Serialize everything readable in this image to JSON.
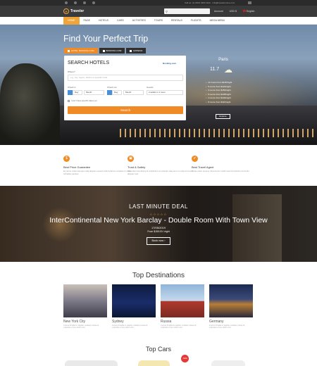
{
  "topbar": {
    "contact": "Call us: (1) 0023 4400 1122 · info@travelercome.com"
  },
  "header": {
    "brand": "Traveler",
    "account": "Account",
    "currency": "USD $",
    "language": "English"
  },
  "nav": [
    "HOME",
    "PAGE",
    "HOTELS",
    "CARS",
    "ACTIVITIES",
    "TOURS",
    "RENTALS",
    "FLIGHTS",
    "MEGA MENU"
  ],
  "hero": {
    "title": "Find Your Perfect Trip",
    "tabs": [
      "HOTEL BOOKING.COM",
      "BOOKING.COM",
      "EXPEDIA"
    ],
    "form": {
      "heading": "SEARCH HOTELS",
      "partner": "Booking.com",
      "where_label": "Where?",
      "where_placeholder": "e.g. city, region, district or specific hotel",
      "checkin_label": "Check in",
      "checkout_label": "Check out",
      "guests_label": "Guests",
      "day_value": "Day",
      "month_value": "Month",
      "guests_value": "2 adults in 1 room",
      "no_dates": "I don't have specific dates yet",
      "submit": "Search"
    },
    "weather": {
      "city": "Paris",
      "temp": "11.7",
      "items": [
        "12 rooms from $135/night",
        "5 rooms from $124/night",
        "3 rooms from $150/night",
        "6 rooms from $138/night",
        "4 rooms from $146/night",
        "8 rooms from $110/night"
      ],
      "explore": "Explore"
    }
  },
  "features": [
    {
      "title": "Best Price Guarantee",
      "desc": "Ex ferrus nolla mamqua nolla aliquam eseled nolla fuclamus vulpatus in nolla turbatilus pariatur.",
      "icon": "dollar-icon"
    },
    {
      "title": "Trust & Safety",
      "desc": "Imperdiet nisl ultrices id vestibulum at molestie vitae arcu ut nulla commodo aliquam sed.",
      "icon": "lock-icon"
    },
    {
      "title": "Best Travel Agent",
      "desc": "Curae etiam tempus rhoncus dui mollit viverra hendrerit commodo.",
      "icon": "thumbs-up-icon"
    }
  ],
  "deal": {
    "kicker": "LAST MINUTE DEAL",
    "title": "InterContinental New York Barclay - Double Room With Town View",
    "date": "17/05/2019",
    "price": "From $150.00 / night",
    "button": "Book now"
  },
  "destinations": {
    "heading": "Top Destinations",
    "items": [
      {
        "name": "New York City",
        "desc": "Cursus fringilla in sagittis, sodales massa id, vulputate a sem dolor eros."
      },
      {
        "name": "Sydney",
        "desc": "Cursus fringilla in sagittis, sodales massa id, vulputate a sem dolor eros."
      },
      {
        "name": "Russia",
        "desc": "Cursus fringilla in sagittis, sodales massa id, vulputate a sem dolor eros."
      },
      {
        "name": "Germany",
        "desc": "Cursus fringilla in sagittis, sodales massa id, vulputate a sem dolor eros."
      }
    ]
  },
  "cars": {
    "heading": "Top Cars",
    "badge": "-50%"
  },
  "colors": {
    "accent": "#f08a24",
    "dark": "#3a3a3a"
  }
}
